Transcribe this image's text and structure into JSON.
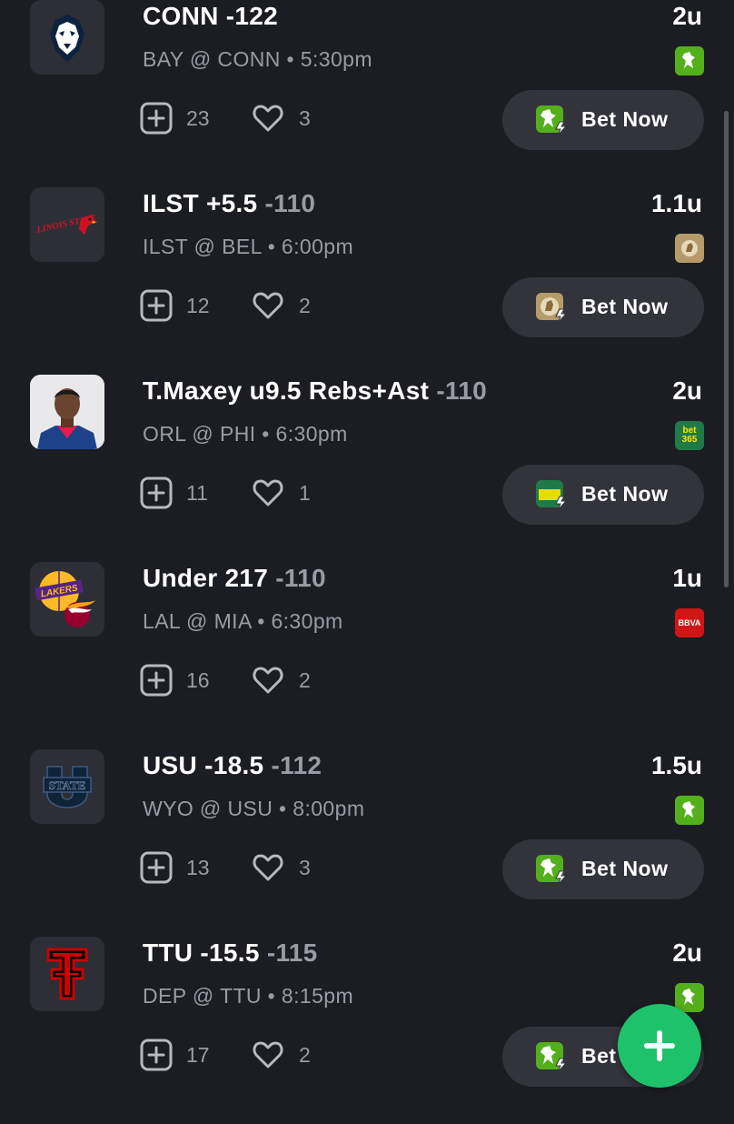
{
  "colors": {
    "background": "#1c1d23",
    "card": "#2d2e36",
    "button": "#32333b",
    "muted_text": "#9a9ba4",
    "fab": "#1ec26a",
    "draftkings": "#53b01c",
    "betmgm": "#b59a6a",
    "bet365": "#1f7a48",
    "bbva": "#cf1515"
  },
  "bet_now_label": "Bet Now",
  "picks": [
    {
      "team_icon": "uconn-husky-logo",
      "pick": "CONN -122",
      "odds": "",
      "units": "2u",
      "matchup": "BAY @ CONN • 5:30pm",
      "tails": "23",
      "likes": "3",
      "book": "draftkings-icon",
      "has_bet_button": true
    },
    {
      "team_icon": "illinois-state-logo",
      "pick": "ILST +5.5",
      "odds": "-110",
      "units": "1.1u",
      "matchup": "ILST @ BEL • 6:00pm",
      "tails": "12",
      "likes": "2",
      "book": "betmgm-icon",
      "has_bet_button": true
    },
    {
      "team_icon": "player-headshot",
      "pick": "T.Maxey u9.5 Rebs+Ast",
      "odds": "-110",
      "units": "2u",
      "matchup": "ORL @ PHI • 6:30pm",
      "tails": "11",
      "likes": "1",
      "book": "bet365-icon",
      "book_text": "bet 365",
      "has_bet_button": true
    },
    {
      "team_icon": "lakers-heat-logo",
      "pick": "Under 217",
      "odds": "-110",
      "units": "1u",
      "matchup": "LAL @ MIA • 6:30pm",
      "tails": "16",
      "likes": "2",
      "book": "bbva-icon",
      "book_text": "BBVA",
      "has_bet_button": false
    },
    {
      "team_icon": "utah-state-logo",
      "pick": "USU -18.5",
      "odds": "-112",
      "units": "1.5u",
      "matchup": "WYO @ USU • 8:00pm",
      "tails": "13",
      "likes": "3",
      "book": "draftkings-icon",
      "has_bet_button": true
    },
    {
      "team_icon": "texas-tech-logo",
      "pick": "TTU -15.5",
      "odds": "-115",
      "units": "2u",
      "matchup": "DEP @ TTU • 8:15pm",
      "tails": "17",
      "likes": "2",
      "book": "draftkings-icon",
      "has_bet_button": true
    }
  ],
  "logo_text": {
    "illinois_state": "ILLINOIS STATE",
    "lakers": "LAKERS",
    "utah_state": "STATE"
  },
  "fab_icon": "plus-icon"
}
